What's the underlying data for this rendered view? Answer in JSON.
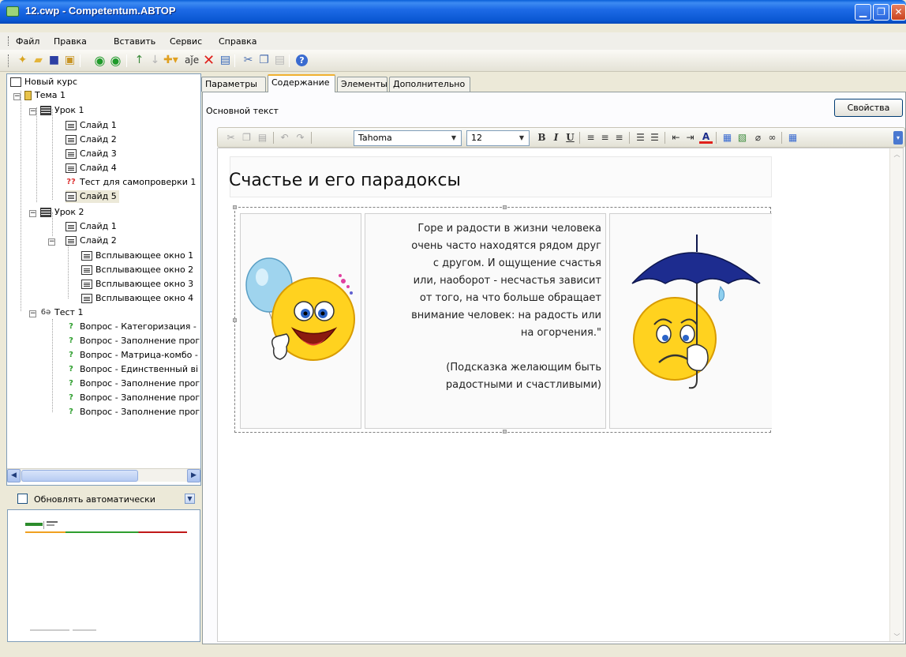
{
  "window": {
    "title": "12.cwp - Competentum.АВТОР",
    "buttons": [
      "minimize",
      "restore",
      "close"
    ]
  },
  "menu": [
    {
      "label": "Файл"
    },
    {
      "label": "Правка"
    },
    {
      "label": "Вставить"
    },
    {
      "label": "Сервис"
    },
    {
      "label": "Справка"
    }
  ],
  "tree": {
    "root": "Новый курс",
    "topic": "Тема 1",
    "lesson1": "Урок 1",
    "lesson1_items": [
      "Слайд 1",
      "Слайд 2",
      "Слайд 3",
      "Слайд 4",
      "Тест для самопроверки 1",
      "Слайд 5"
    ],
    "lesson2": "Урок 2",
    "lesson2_slide1": "Слайд 1",
    "lesson2_slide2": "Слайд 2",
    "popups": [
      "Всплывающее окно 1",
      "Всплывающее окно 2",
      "Всплывающее окно 3",
      "Всплывающее окно 4"
    ],
    "test": "Тест 1",
    "questions": [
      "Вопрос - Категоризация -",
      "Вопрос - Заполнение прог",
      "Вопрос - Матрица-комбо -",
      "Вопрос - Единственный ві",
      "Вопрос - Заполнение прог",
      "Вопрос - Заполнение прог",
      "Вопрос - Заполнение прог"
    ],
    "selected": "Слайд 5"
  },
  "auto_update": {
    "label": "Обновлять автоматически",
    "checked": false
  },
  "tabs": [
    {
      "label": "Параметры",
      "active": false
    },
    {
      "label": "Содержание",
      "active": true
    },
    {
      "label": "Элементы",
      "active": false
    },
    {
      "label": "Дополнительно",
      "active": false
    }
  ],
  "content": {
    "basic_text_label": "Основной текст",
    "properties_button": "Свойства"
  },
  "editor_toolbar": {
    "font": "Tahoma",
    "size": "12"
  },
  "slide": {
    "title": "Счастье и его парадоксы",
    "body_lines": [
      "Горе и радости в жизни человека",
      "очень часто находятся рядом друг",
      "с другом. И ощущение счастья",
      "или, наоборот - несчастья зависит",
      "от того, на что больше обращает",
      "внимание человек: на радость или",
      "на огорчения.\""
    ],
    "hint_lines": [
      "(Подсказка желающим быть",
      "радостными и счастливыми)"
    ],
    "left_image": "happy-smiley-with-balloon",
    "right_image": "sad-smiley-with-umbrella"
  },
  "colors": {
    "titlebar": "#0a58d3",
    "tab_highlight": "#f0b030",
    "smiley_yellow": "#ffd21f",
    "umbrella": "#1d2c8f"
  }
}
